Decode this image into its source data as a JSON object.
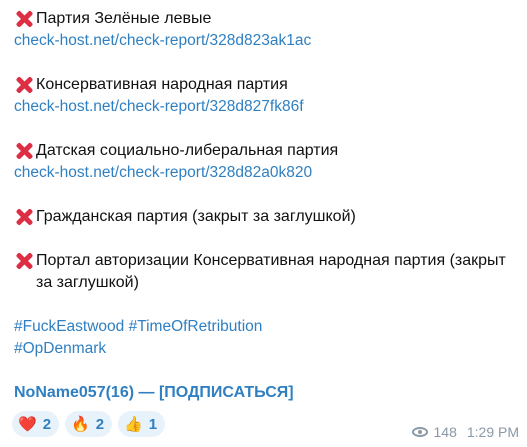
{
  "entries": [
    {
      "title": "Партия Зелёные левые",
      "link": "check-host.net/check-report/328d823ak1ac"
    },
    {
      "title": "Консервативная народная партия",
      "link": "check-host.net/check-report/328d827fk86f"
    },
    {
      "title": "Датская социально-либеральная партия",
      "link": "check-host.net/check-report/328d82a0k820"
    },
    {
      "title": "Гражданская партия (закрыт за заглушкой)"
    },
    {
      "title": "Портал авторизации Консервативная народная партия (закрыт за заглушкой)"
    }
  ],
  "hashtags": [
    "#FuckEastwood #TimeOfRetribution",
    "#OpDenmark"
  ],
  "signature": "NoName057(16) — [ПОДПИСАТЬСЯ]",
  "reactions": [
    {
      "emoji": "❤️",
      "icon": "heart-icon",
      "count": "2"
    },
    {
      "emoji": "🔥",
      "icon": "fire-icon",
      "count": "2"
    },
    {
      "emoji": "👍",
      "icon": "thumbs-up-icon",
      "count": "1"
    }
  ],
  "meta": {
    "views": "148",
    "time": "1:29 PM"
  },
  "colors": {
    "link": "#2f7fc1",
    "cross": "#dd2e44",
    "reaction_bg": "#e8f2fb"
  }
}
